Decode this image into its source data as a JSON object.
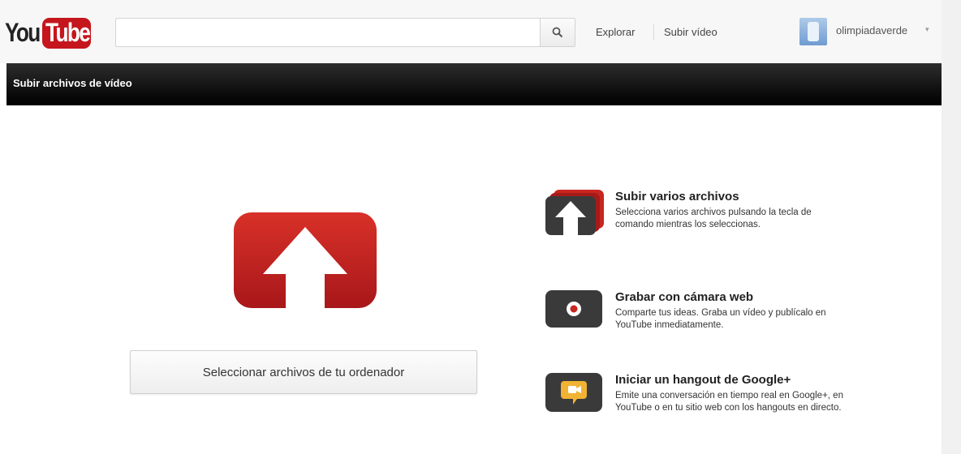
{
  "header": {
    "logo": {
      "text_you": "You",
      "text_tube": "Tube"
    },
    "search": {
      "value": "",
      "placeholder": ""
    },
    "nav": {
      "explore": "Explorar",
      "upload": "Subir vídeo"
    },
    "user": {
      "name": "olimpiadaverde",
      "caret": "▾"
    }
  },
  "title_bar": {
    "title": "Subir archivos de vídeo"
  },
  "main": {
    "select_button": "Seleccionar archivos de tu ordenador"
  },
  "options": [
    {
      "title": "Subir varios archivos",
      "description": "Selecciona varios archivos pulsando la tecla de comando mientras los seleccionas.",
      "icon": "multi-upload-icon"
    },
    {
      "title": "Grabar con cámara web",
      "description": "Comparte tus ideas. Graba un vídeo y publícalo en YouTube inmediatamente.",
      "icon": "webcam-record-icon"
    },
    {
      "title": "Iniciar un hangout de Google+",
      "description": "Emite una conversación en tiempo real en Google+, en YouTube o en tu sitio web con los hangouts en directo.",
      "icon": "hangout-icon"
    }
  ],
  "colors": {
    "brand_red": "#c4161c",
    "upload_red": "#c8261f",
    "title_bar": "#111111",
    "hangout_yellow": "#f2b233"
  }
}
